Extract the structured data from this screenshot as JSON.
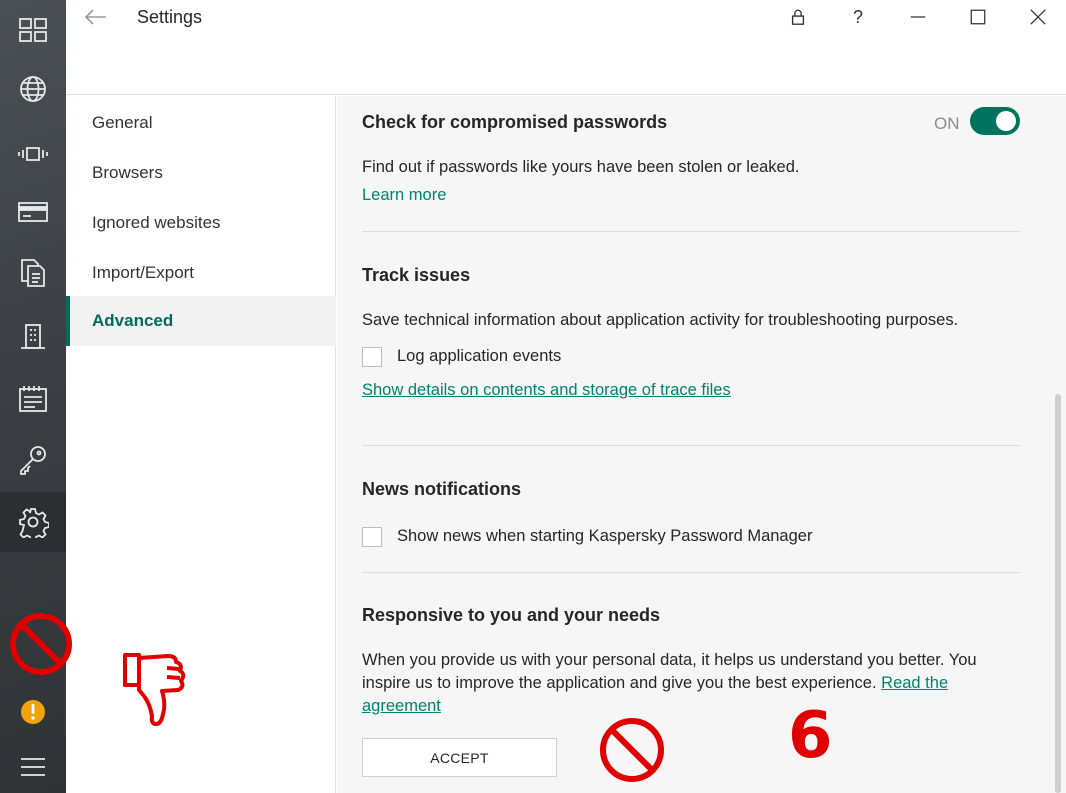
{
  "window": {
    "title": "Settings",
    "icons": [
      "back-arrow-icon",
      "lock-icon",
      "help-icon",
      "minimize-icon",
      "maximize-icon",
      "close-icon"
    ]
  },
  "rail": {
    "icons": [
      "dashboard-icon",
      "globe-icon",
      "carousel-icon",
      "credit-card-icon",
      "documents-icon",
      "building-icon",
      "notepad-icon",
      "key-icon",
      "settings-gear-icon",
      "warning-icon",
      "menu-icon"
    ],
    "active": "settings-gear-icon"
  },
  "nav": {
    "items": [
      {
        "label": "General"
      },
      {
        "label": "Browsers"
      },
      {
        "label": "Ignored websites"
      },
      {
        "label": "Import/Export"
      },
      {
        "label": "Advanced"
      }
    ],
    "active_index": 4
  },
  "sections": {
    "compromised": {
      "title": "Check for compromised passwords",
      "toggle_state": "ON",
      "toggle_on": true,
      "description": "Find out if passwords like yours have been stolen or leaked.",
      "learn_more": "Learn more"
    },
    "track": {
      "title": "Track issues",
      "description": "Save technical information about application activity for troubleshooting purposes.",
      "checkbox_label": "Log application events",
      "checked": false,
      "link": "Show details on contents and storage of trace files"
    },
    "news": {
      "title": "News notifications",
      "checkbox_label": "Show news when starting Kaspersky Password Manager",
      "checked": false
    },
    "responsive": {
      "title": "Responsive to you and your needs",
      "description_line1": "When you provide us with your personal data, it helps us understand you better. You",
      "description_line2": "inspire us to improve the application and give you the best experience.",
      "link_part1": "Read the",
      "link_part2": "agreement",
      "accept_label": "ACCEPT"
    }
  },
  "annotations": {
    "number": "6",
    "color": "#e00000"
  },
  "colors": {
    "accent": "#00846c",
    "toggle": "#00735e",
    "rail": "#3c4044"
  }
}
